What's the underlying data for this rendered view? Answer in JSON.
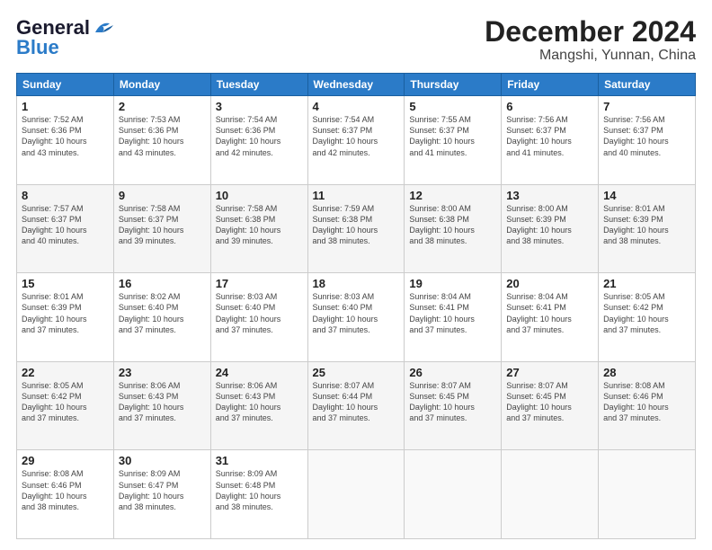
{
  "logo": {
    "line1": "General",
    "line2": "Blue"
  },
  "title": "December 2024",
  "subtitle": "Mangshi, Yunnan, China",
  "days_of_week": [
    "Sunday",
    "Monday",
    "Tuesday",
    "Wednesday",
    "Thursday",
    "Friday",
    "Saturday"
  ],
  "weeks": [
    [
      {
        "day": "1",
        "info": "Sunrise: 7:52 AM\nSunset: 6:36 PM\nDaylight: 10 hours\nand 43 minutes."
      },
      {
        "day": "2",
        "info": "Sunrise: 7:53 AM\nSunset: 6:36 PM\nDaylight: 10 hours\nand 43 minutes."
      },
      {
        "day": "3",
        "info": "Sunrise: 7:54 AM\nSunset: 6:36 PM\nDaylight: 10 hours\nand 42 minutes."
      },
      {
        "day": "4",
        "info": "Sunrise: 7:54 AM\nSunset: 6:37 PM\nDaylight: 10 hours\nand 42 minutes."
      },
      {
        "day": "5",
        "info": "Sunrise: 7:55 AM\nSunset: 6:37 PM\nDaylight: 10 hours\nand 41 minutes."
      },
      {
        "day": "6",
        "info": "Sunrise: 7:56 AM\nSunset: 6:37 PM\nDaylight: 10 hours\nand 41 minutes."
      },
      {
        "day": "7",
        "info": "Sunrise: 7:56 AM\nSunset: 6:37 PM\nDaylight: 10 hours\nand 40 minutes."
      }
    ],
    [
      {
        "day": "8",
        "info": "Sunrise: 7:57 AM\nSunset: 6:37 PM\nDaylight: 10 hours\nand 40 minutes."
      },
      {
        "day": "9",
        "info": "Sunrise: 7:58 AM\nSunset: 6:37 PM\nDaylight: 10 hours\nand 39 minutes."
      },
      {
        "day": "10",
        "info": "Sunrise: 7:58 AM\nSunset: 6:38 PM\nDaylight: 10 hours\nand 39 minutes."
      },
      {
        "day": "11",
        "info": "Sunrise: 7:59 AM\nSunset: 6:38 PM\nDaylight: 10 hours\nand 38 minutes."
      },
      {
        "day": "12",
        "info": "Sunrise: 8:00 AM\nSunset: 6:38 PM\nDaylight: 10 hours\nand 38 minutes."
      },
      {
        "day": "13",
        "info": "Sunrise: 8:00 AM\nSunset: 6:39 PM\nDaylight: 10 hours\nand 38 minutes."
      },
      {
        "day": "14",
        "info": "Sunrise: 8:01 AM\nSunset: 6:39 PM\nDaylight: 10 hours\nand 38 minutes."
      }
    ],
    [
      {
        "day": "15",
        "info": "Sunrise: 8:01 AM\nSunset: 6:39 PM\nDaylight: 10 hours\nand 37 minutes."
      },
      {
        "day": "16",
        "info": "Sunrise: 8:02 AM\nSunset: 6:40 PM\nDaylight: 10 hours\nand 37 minutes."
      },
      {
        "day": "17",
        "info": "Sunrise: 8:03 AM\nSunset: 6:40 PM\nDaylight: 10 hours\nand 37 minutes."
      },
      {
        "day": "18",
        "info": "Sunrise: 8:03 AM\nSunset: 6:40 PM\nDaylight: 10 hours\nand 37 minutes."
      },
      {
        "day": "19",
        "info": "Sunrise: 8:04 AM\nSunset: 6:41 PM\nDaylight: 10 hours\nand 37 minutes."
      },
      {
        "day": "20",
        "info": "Sunrise: 8:04 AM\nSunset: 6:41 PM\nDaylight: 10 hours\nand 37 minutes."
      },
      {
        "day": "21",
        "info": "Sunrise: 8:05 AM\nSunset: 6:42 PM\nDaylight: 10 hours\nand 37 minutes."
      }
    ],
    [
      {
        "day": "22",
        "info": "Sunrise: 8:05 AM\nSunset: 6:42 PM\nDaylight: 10 hours\nand 37 minutes."
      },
      {
        "day": "23",
        "info": "Sunrise: 8:06 AM\nSunset: 6:43 PM\nDaylight: 10 hours\nand 37 minutes."
      },
      {
        "day": "24",
        "info": "Sunrise: 8:06 AM\nSunset: 6:43 PM\nDaylight: 10 hours\nand 37 minutes."
      },
      {
        "day": "25",
        "info": "Sunrise: 8:07 AM\nSunset: 6:44 PM\nDaylight: 10 hours\nand 37 minutes."
      },
      {
        "day": "26",
        "info": "Sunrise: 8:07 AM\nSunset: 6:45 PM\nDaylight: 10 hours\nand 37 minutes."
      },
      {
        "day": "27",
        "info": "Sunrise: 8:07 AM\nSunset: 6:45 PM\nDaylight: 10 hours\nand 37 minutes."
      },
      {
        "day": "28",
        "info": "Sunrise: 8:08 AM\nSunset: 6:46 PM\nDaylight: 10 hours\nand 37 minutes."
      }
    ],
    [
      {
        "day": "29",
        "info": "Sunrise: 8:08 AM\nSunset: 6:46 PM\nDaylight: 10 hours\nand 38 minutes."
      },
      {
        "day": "30",
        "info": "Sunrise: 8:09 AM\nSunset: 6:47 PM\nDaylight: 10 hours\nand 38 minutes."
      },
      {
        "day": "31",
        "info": "Sunrise: 8:09 AM\nSunset: 6:48 PM\nDaylight: 10 hours\nand 38 minutes."
      },
      {
        "day": "",
        "info": ""
      },
      {
        "day": "",
        "info": ""
      },
      {
        "day": "",
        "info": ""
      },
      {
        "day": "",
        "info": ""
      }
    ]
  ]
}
